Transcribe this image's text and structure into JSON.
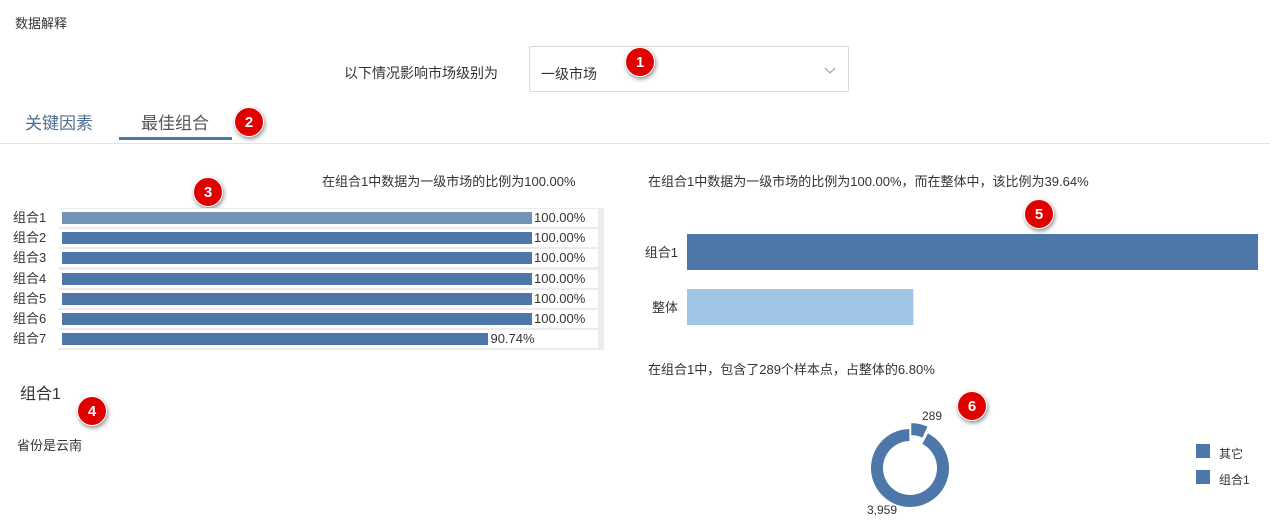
{
  "page": {
    "title": "数据解释"
  },
  "filter": {
    "label": "以下情况影响市场级别为",
    "selected": "一级市场"
  },
  "markers": [
    "1",
    "2",
    "3",
    "4",
    "5",
    "6"
  ],
  "tabs": [
    {
      "label": "关键因素"
    },
    {
      "label": "最佳组合",
      "active": true
    }
  ],
  "left_panel": {
    "caption": "在组合1中数据为一级市场的比例为100.00%",
    "detail_title": "组合1",
    "detail_desc": "省份是云南"
  },
  "right_panel": {
    "caption": "在组合1中数据为一级市场的比例为100.00%，而在整体中，该比例为39.64%",
    "sample_caption": "在组合1中，包含了289个样本点，占整体的6.80%",
    "legend": [
      "其它",
      "组合1"
    ]
  },
  "colors": {
    "primary_bar": "#4c77a8",
    "light_bar": "#9fc6e6",
    "marker": "#e00000",
    "tab_active": "#4f77a4"
  },
  "chart_data": [
    {
      "type": "bar",
      "orientation": "horizontal",
      "categories": [
        "组合1",
        "组合2",
        "组合3",
        "组合4",
        "组合5",
        "组合6",
        "组合7"
      ],
      "values": [
        100.0,
        100.0,
        100.0,
        100.0,
        100.0,
        100.0,
        90.74
      ],
      "value_labels": [
        "100.00%",
        "100.00%",
        "100.00%",
        "100.00%",
        "100.00%",
        "100.00%",
        "90.74%"
      ],
      "xlim": [
        0,
        100
      ]
    },
    {
      "type": "bar",
      "orientation": "horizontal",
      "categories": [
        "组合1",
        "整体"
      ],
      "values": [
        100.0,
        39.64
      ],
      "xlim": [
        0,
        100
      ]
    },
    {
      "type": "pie",
      "donut": true,
      "labels": [
        "组合1",
        "其它"
      ],
      "values": [
        289,
        3959
      ],
      "value_labels": [
        "289",
        "3,959"
      ]
    }
  ]
}
